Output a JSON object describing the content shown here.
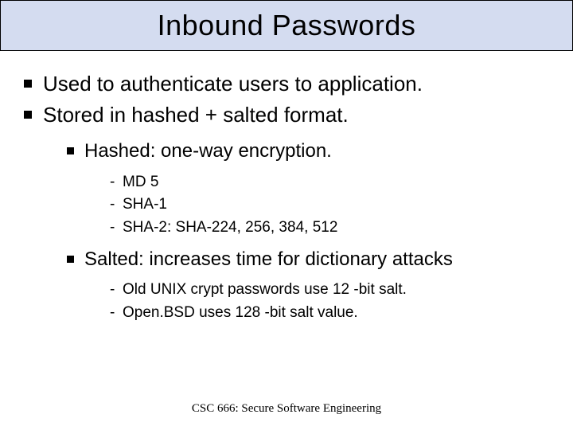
{
  "title": "Inbound Passwords",
  "bullets": {
    "b0": "Used to authenticate users to application.",
    "b1": "Stored in hashed + salted format.",
    "sub0": "Hashed: one-way encryption.",
    "sub0_items": {
      "i0": "MD 5",
      "i1": "SHA-1",
      "i2": "SHA-2: SHA-224, 256, 384, 512"
    },
    "sub1": "Salted: increases time for dictionary attacks",
    "sub1_items": {
      "i0": "Old UNIX crypt passwords use 12 -bit salt.",
      "i1": "Open.BSD uses 128 -bit salt value."
    }
  },
  "footer": "CSC 666: Secure Software Engineering"
}
